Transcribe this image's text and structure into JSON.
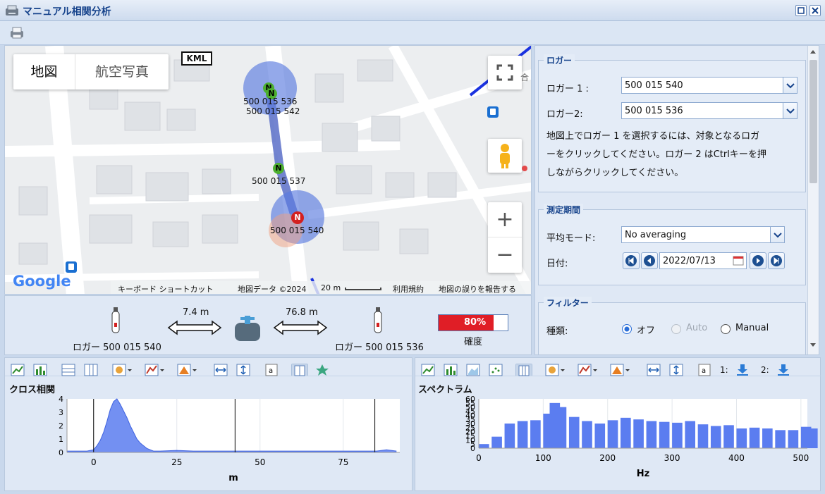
{
  "window": {
    "title": "マニュアル相関分析"
  },
  "map": {
    "type_buttons": [
      "地図",
      "航空写真"
    ],
    "kml": "KML",
    "loggers": [
      {
        "id": "500 015 536",
        "marker": "N"
      },
      {
        "id": "500 015 542",
        "marker": "N"
      },
      {
        "id": "500 015 537",
        "marker": "N"
      },
      {
        "id": "500 015 540",
        "marker": "N"
      }
    ],
    "attribution": {
      "logo": "Google",
      "shortcuts": "キーボード ショートカット",
      "mapdata": "地図データ ©2024",
      "scale": "20 m",
      "terms": "利用規約",
      "report": "地図の誤りを報告する"
    },
    "poi_fragment": "合",
    "controls": {
      "zoom_in": "+",
      "zoom_out": "−"
    }
  },
  "distance": {
    "left_logger": "ロガー 500 015 540",
    "left_dist": "7.4 m",
    "right_logger": "ロガー 500 015 536",
    "right_dist": "76.8 m",
    "confidence": "80%",
    "confidence_value": 80,
    "confidence_label": "確度"
  },
  "loggers_panel": {
    "legend": "ロガー",
    "logger1_label": "ロガー 1 :",
    "logger1_value": "500 015 540",
    "logger2_label": "ロガー2:",
    "logger2_value": "500 015 536",
    "help_lines": [
      "地図上でロガー 1 を選択するには、対象となるロガ",
      "ーをクリックしてください。ロガー 2 はCtrlキーを押",
      "しながらクリックしてください。"
    ]
  },
  "period": {
    "legend": "測定期間",
    "mode_label": "平均モード:",
    "mode_value": "No averaging",
    "date_label": "日付:",
    "date_value": "2022/07/13"
  },
  "filter": {
    "legend": "フィルター",
    "type_label": "種類:",
    "options": [
      {
        "label": "オフ",
        "selected": true,
        "disabled": false
      },
      {
        "label": "Auto",
        "selected": false,
        "disabled": true
      },
      {
        "label": "Manual",
        "selected": false,
        "disabled": false
      }
    ]
  },
  "colors": {
    "accent": "#15428b",
    "series": "#5b7df0",
    "conf_fill": "#e01e26"
  },
  "chart_data": [
    {
      "type": "line",
      "title": "クロス相関",
      "xlabel": "m",
      "ylabel": "",
      "xlim": [
        -8,
        92
      ],
      "ylim": [
        0,
        4
      ],
      "yticks": [
        0,
        1,
        2,
        3,
        4
      ],
      "xticks": [
        0,
        25,
        50,
        75
      ],
      "vlines": [
        0,
        42.5,
        84.5
      ],
      "x": [
        -8,
        -5,
        -2,
        0,
        1,
        2,
        3,
        4,
        5,
        6,
        7,
        8,
        9,
        10,
        11,
        12,
        13,
        14,
        15,
        16,
        17,
        18,
        20,
        25,
        30,
        35,
        40,
        45,
        50,
        55,
        60,
        65,
        70,
        75,
        80,
        85,
        88,
        91
      ],
      "y": [
        0.1,
        0.1,
        0.1,
        0.2,
        0.5,
        0.9,
        1.5,
        2.3,
        3.2,
        3.8,
        4,
        3.6,
        3.1,
        2.6,
        2,
        1.5,
        1,
        0.7,
        0.5,
        0.3,
        0.2,
        0.1,
        0.1,
        0.15,
        0.1,
        0.1,
        0.1,
        0.1,
        0.1,
        0.1,
        0.1,
        0.1,
        0.1,
        0.1,
        0.1,
        0.1,
        0.2,
        0.1
      ]
    },
    {
      "type": "bar",
      "title": "スペクトラム",
      "xlabel": "Hz",
      "ylabel": "",
      "xlim": [
        0,
        510
      ],
      "ylim": [
        0,
        60
      ],
      "yticks": [
        0,
        5,
        10,
        15,
        20,
        25,
        30,
        35,
        40,
        45,
        50,
        55,
        60
      ],
      "xticks": [
        0,
        100,
        200,
        300,
        400,
        500
      ],
      "x": [
        0,
        20,
        40,
        60,
        80,
        100,
        110,
        120,
        140,
        160,
        180,
        200,
        220,
        240,
        260,
        280,
        300,
        320,
        340,
        360,
        380,
        400,
        420,
        440,
        460,
        480,
        500,
        510
      ],
      "y": [
        5,
        14,
        30,
        33,
        34,
        42,
        55,
        50,
        38,
        33,
        30,
        34,
        37,
        35,
        33,
        32,
        31,
        33,
        29,
        27,
        28,
        24,
        25,
        24,
        22,
        22,
        26,
        24
      ]
    }
  ]
}
